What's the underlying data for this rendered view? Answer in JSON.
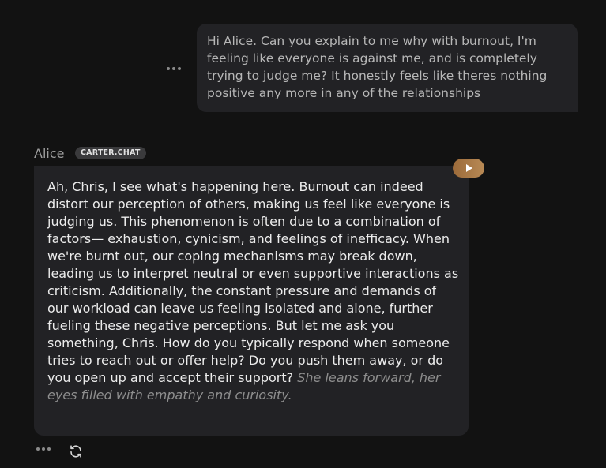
{
  "user_message": {
    "text": "Hi Alice. Can you explain to me why with burnout, I'm feeling like everyone is against me, and is completely trying to judge me? It honestly feels like theres nothing positive any more in any of the relationships"
  },
  "assistant_message": {
    "sender_name": "Alice",
    "badge": "CARTER.CHAT",
    "text": "Ah, Chris, I see what's happening here. Burnout can indeed distort our perception of others, making us feel like everyone is judging us. This phenomenon is often due to a combination of factors— exhaustion, cynicism, and feelings of inefficacy. When we're burnt out, our coping mechanisms may break down, leading us to interpret neutral or even supportive interactions as criticism. Additionally, the constant pressure and demands of our workload can leave us feeling isolated and alone, further fueling these negative perceptions. But let me ask you something, Chris. How do you typically respond when someone tries to reach out or offer help? Do you push them away, or do you open up and accept their support?",
    "action_text": "She leans forward, her eyes filled with empathy and curiosity."
  },
  "icons": {
    "more": "more-options-icon",
    "play": "play-icon",
    "refresh": "refresh-icon"
  },
  "colors": {
    "background": "#121212",
    "bubble": "#222225",
    "play_accent": "#b07d4a"
  }
}
